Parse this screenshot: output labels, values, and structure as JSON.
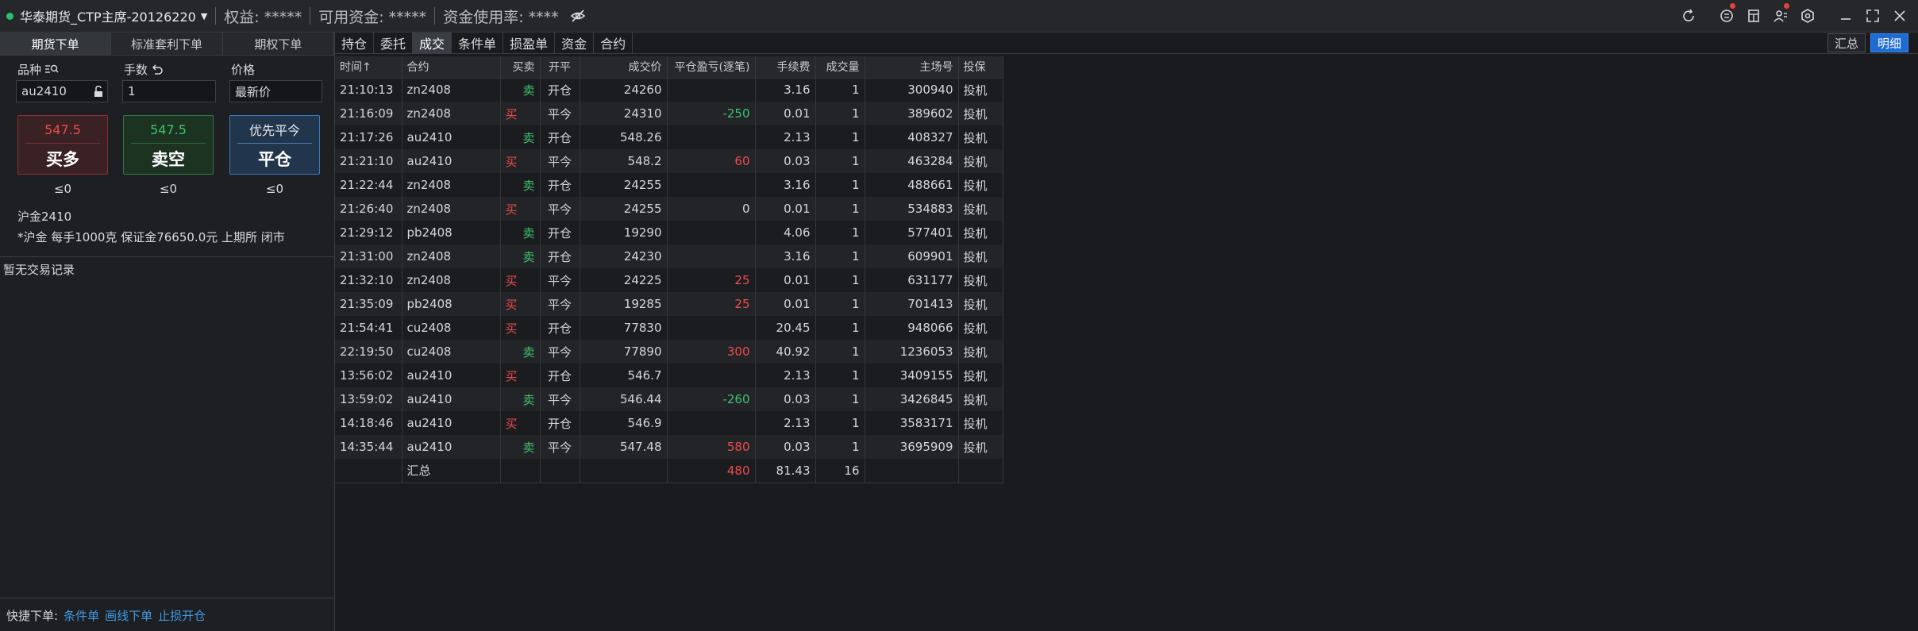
{
  "titlebar": {
    "account": "华泰期货_CTP主席-20126220",
    "equity": "权益: *****",
    "available": "可用资金: *****",
    "usage": "资金使用率: ****",
    "icons": [
      "refresh-icon",
      "message-icon",
      "calculator-icon",
      "user-settings-icon",
      "settings-icon",
      "minimize-icon",
      "maximize-icon",
      "close-icon"
    ]
  },
  "left": {
    "tabs": [
      "期货下单",
      "标准套利下单",
      "期权下单"
    ],
    "active_tab": 0,
    "labels": {
      "symbol": "品种",
      "lots": "手数",
      "price": "价格"
    },
    "inputs": {
      "symbol": "au2410",
      "lots": "1",
      "price": "最新价"
    },
    "buttons": {
      "buy": {
        "price": "547.5",
        "label": "买多",
        "qty": "≤0"
      },
      "sell": {
        "price": "547.5",
        "label": "卖空",
        "qty": "≤0"
      },
      "close": {
        "top": "优先平今",
        "label": "平仓",
        "qty": "≤0"
      }
    },
    "product_name": "沪金2410",
    "product_info": "*沪金 每手1000克 保证金76650.0元 上期所 闭市",
    "no_records": "暂无交易记录",
    "quick": {
      "label": "快捷下单:",
      "links": [
        "条件单",
        "画线下单",
        "止损开仓"
      ]
    }
  },
  "right": {
    "tabs": [
      "持仓",
      "委托",
      "成交",
      "条件单",
      "损盈单",
      "资金",
      "合约"
    ],
    "active_tab": 2,
    "view_buttons": [
      "汇总",
      "明细"
    ],
    "active_view": 1,
    "columns": [
      "时间↑",
      "合约",
      "买卖",
      "开平",
      "成交价",
      "平仓盈亏(逐笔)",
      "手续费",
      "成交量",
      "主场号",
      "投保"
    ],
    "rows": [
      {
        "time": "21:10:13",
        "contract": "zn2408",
        "side": "卖",
        "oc": "开仓",
        "price": "24260",
        "pnl": "",
        "fee": "3.16",
        "vol": "1",
        "id": "300940",
        "hedge": "投机"
      },
      {
        "time": "21:16:09",
        "contract": "zn2408",
        "side": "买",
        "oc": "平今",
        "price": "24310",
        "pnl": "-250",
        "fee": "0.01",
        "vol": "1",
        "id": "389602",
        "hedge": "投机"
      },
      {
        "time": "21:17:26",
        "contract": "au2410",
        "side": "卖",
        "oc": "开仓",
        "price": "548.26",
        "pnl": "",
        "fee": "2.13",
        "vol": "1",
        "id": "408327",
        "hedge": "投机"
      },
      {
        "time": "21:21:10",
        "contract": "au2410",
        "side": "买",
        "oc": "平今",
        "price": "548.2",
        "pnl": "60",
        "fee": "0.03",
        "vol": "1",
        "id": "463284",
        "hedge": "投机"
      },
      {
        "time": "21:22:44",
        "contract": "zn2408",
        "side": "卖",
        "oc": "开仓",
        "price": "24255",
        "pnl": "",
        "fee": "3.16",
        "vol": "1",
        "id": "488661",
        "hedge": "投机"
      },
      {
        "time": "21:26:40",
        "contract": "zn2408",
        "side": "买",
        "oc": "平今",
        "price": "24255",
        "pnl": "0",
        "fee": "0.01",
        "vol": "1",
        "id": "534883",
        "hedge": "投机"
      },
      {
        "time": "21:29:12",
        "contract": "pb2408",
        "side": "卖",
        "oc": "开仓",
        "price": "19290",
        "pnl": "",
        "fee": "4.06",
        "vol": "1",
        "id": "577401",
        "hedge": "投机"
      },
      {
        "time": "21:31:00",
        "contract": "zn2408",
        "side": "卖",
        "oc": "开仓",
        "price": "24230",
        "pnl": "",
        "fee": "3.16",
        "vol": "1",
        "id": "609901",
        "hedge": "投机"
      },
      {
        "time": "21:32:10",
        "contract": "zn2408",
        "side": "买",
        "oc": "平今",
        "price": "24225",
        "pnl": "25",
        "fee": "0.01",
        "vol": "1",
        "id": "631177",
        "hedge": "投机"
      },
      {
        "time": "21:35:09",
        "contract": "pb2408",
        "side": "买",
        "oc": "平今",
        "price": "19285",
        "pnl": "25",
        "fee": "0.01",
        "vol": "1",
        "id": "701413",
        "hedge": "投机"
      },
      {
        "time": "21:54:41",
        "contract": "cu2408",
        "side": "买",
        "oc": "开仓",
        "price": "77830",
        "pnl": "",
        "fee": "20.45",
        "vol": "1",
        "id": "948066",
        "hedge": "投机"
      },
      {
        "time": "22:19:50",
        "contract": "cu2408",
        "side": "卖",
        "oc": "平今",
        "price": "77890",
        "pnl": "300",
        "fee": "40.92",
        "vol": "1",
        "id": "1236053",
        "hedge": "投机"
      },
      {
        "time": "13:56:02",
        "contract": "au2410",
        "side": "买",
        "oc": "开仓",
        "price": "546.7",
        "pnl": "",
        "fee": "2.13",
        "vol": "1",
        "id": "3409155",
        "hedge": "投机"
      },
      {
        "time": "13:59:02",
        "contract": "au2410",
        "side": "卖",
        "oc": "平今",
        "price": "546.44",
        "pnl": "-260",
        "fee": "0.03",
        "vol": "1",
        "id": "3426845",
        "hedge": "投机"
      },
      {
        "time": "14:18:46",
        "contract": "au2410",
        "side": "买",
        "oc": "开仓",
        "price": "546.9",
        "pnl": "",
        "fee": "2.13",
        "vol": "1",
        "id": "3583171",
        "hedge": "投机"
      },
      {
        "time": "14:35:44",
        "contract": "au2410",
        "side": "卖",
        "oc": "平今",
        "price": "547.48",
        "pnl": "580",
        "fee": "0.03",
        "vol": "1",
        "id": "3695909",
        "hedge": "投机"
      }
    ],
    "summary": {
      "label": "汇总",
      "pnl": "480",
      "fee": "81.43",
      "vol": "16"
    }
  },
  "colors": {
    "buy": "#f04b4b",
    "sell": "#3ec46d",
    "accent": "#1e6bd1",
    "link": "#3e9be6"
  }
}
